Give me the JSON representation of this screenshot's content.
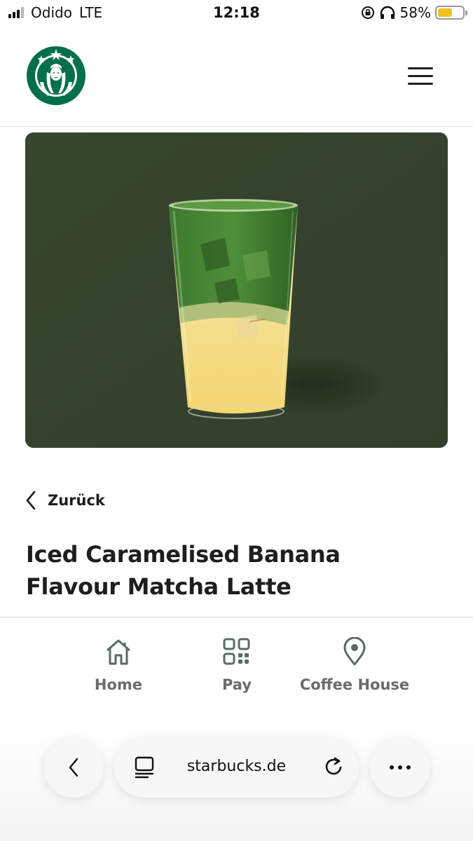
{
  "status_bar": {
    "carrier": "Odido",
    "network": "LTE",
    "time": "12:18",
    "battery_percent": "58%",
    "battery_level": 0.58,
    "battery_color": "#f2c31e",
    "icons": [
      "signal-icon",
      "orientation-lock-icon",
      "headphones-icon",
      "battery-icon"
    ]
  },
  "header": {
    "logo": "starbucks-siren-logo",
    "brand_color": "#00704a",
    "menu_icon": "hamburger-menu-icon"
  },
  "hero": {
    "background_color": "#354330",
    "image": "iced-matcha-latte-glass"
  },
  "back": {
    "label": "Zurück",
    "icon": "chevron-left-icon"
  },
  "product": {
    "title_line1": "Iced Caramelised Banana",
    "title_line2": "Flavour Matcha Latte"
  },
  "bottom_nav": {
    "items": [
      {
        "label": "Home",
        "icon": "home-icon"
      },
      {
        "label": "Pay",
        "icon": "qr-code-icon"
      },
      {
        "label": "Coffee House",
        "icon": "location-pin-icon"
      }
    ]
  },
  "browser": {
    "url": "starbucks.de",
    "back_icon": "chevron-left-icon",
    "reader_icon": "reader-mode-icon",
    "reload_icon": "reload-icon",
    "more_icon": "more-dots-icon"
  }
}
